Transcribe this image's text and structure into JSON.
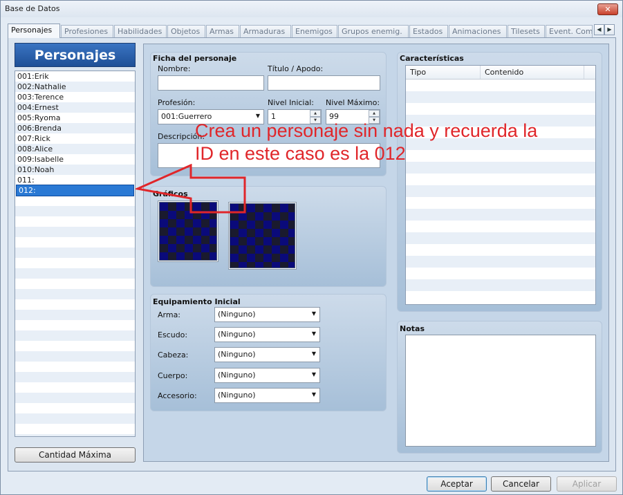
{
  "window": {
    "title": "Base de Datos",
    "close_glyph": "✕"
  },
  "tabs": [
    {
      "label": "Personajes",
      "active": true
    },
    {
      "label": "Profesiones"
    },
    {
      "label": "Habilidades"
    },
    {
      "label": "Objetos"
    },
    {
      "label": "Armas"
    },
    {
      "label": "Armaduras"
    },
    {
      "label": "Enemigos"
    },
    {
      "label": "Grupos enemig."
    },
    {
      "label": "Estados"
    },
    {
      "label": "Animaciones"
    },
    {
      "label": "Tilesets"
    },
    {
      "label": "Event. Com"
    }
  ],
  "tab_scroll": {
    "left": "◀",
    "right": "▶"
  },
  "left_panel": {
    "header": "Personajes",
    "characters": [
      "001:Erik",
      "002:Nathalie",
      "003:Terence",
      "004:Ernest",
      "005:Ryoma",
      "006:Brenda",
      "007:Rick",
      "008:Alice",
      "009:Isabelle",
      "010:Noah",
      "011:",
      "012:"
    ],
    "selected_index": 11,
    "qty_button": "Cantidad Máxima"
  },
  "ficha": {
    "title": "Ficha del personaje",
    "nombre_label": "Nombre:",
    "nombre_value": "",
    "titulo_label": "Título / Apodo:",
    "titulo_value": "",
    "profesion_label": "Profesión:",
    "profesion_value": "001:Guerrero",
    "nivel_inicial_label": "Nivel Inicial:",
    "nivel_inicial_value": "1",
    "nivel_maximo_label": "Nivel Máximo:",
    "nivel_maximo_value": "99",
    "descripcion_label": "Descripción:",
    "descripcion_value": ""
  },
  "graficos": {
    "title": "Gráficos"
  },
  "equipamiento": {
    "title": "Equipamiento Inicial",
    "slots": [
      {
        "label": "Arma:",
        "value": "(Ninguno)"
      },
      {
        "label": "Escudo:",
        "value": "(Ninguno)"
      },
      {
        "label": "Cabeza:",
        "value": "(Ninguno)"
      },
      {
        "label": "Cuerpo:",
        "value": "(Ninguno)"
      },
      {
        "label": "Accesorio:",
        "value": "(Ninguno)"
      }
    ]
  },
  "caracteristicas": {
    "title": "Características",
    "columns": [
      "Tipo",
      "Contenido"
    ]
  },
  "notas": {
    "title": "Notas",
    "value": ""
  },
  "annotation": {
    "line1": "Crea un personaje sin nada y recuerda la",
    "line2": "ID en este caso es la 012",
    "color": "#e0262a"
  },
  "buttons": {
    "ok": "Aceptar",
    "cancel": "Cancelar",
    "apply": "Aplicar"
  }
}
